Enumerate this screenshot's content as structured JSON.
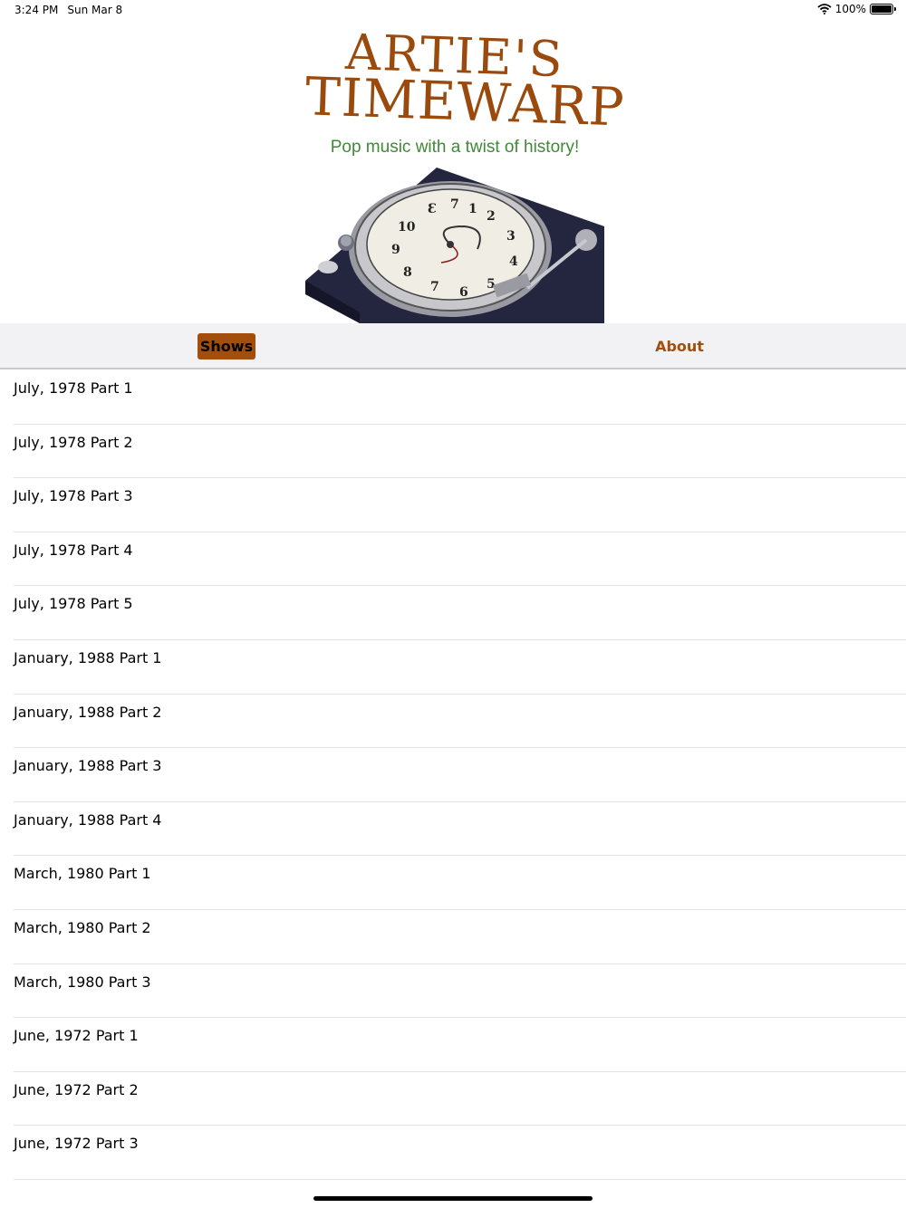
{
  "status_bar": {
    "time": "3:24 PM",
    "date": "Sun Mar 8",
    "battery": "100%",
    "battery_level": 1.0
  },
  "logo": {
    "title_line1": "ARTIE'S",
    "title_line2": "TIMEWARP",
    "tagline": "Pop music with a twist of history!"
  },
  "tabs": {
    "shows": "Shows",
    "about": "About",
    "selected": "Shows"
  },
  "shows": [
    "July, 1978 Part 1",
    "July, 1978 Part 2",
    "July, 1978 Part 3",
    "July, 1978 Part 4",
    "July, 1978 Part 5",
    "January, 1988 Part 1",
    "January, 1988 Part 2",
    "January, 1988 Part 3",
    "January, 1988 Part 4",
    "March, 1980 Part 1",
    "March, 1980 Part 2",
    "March, 1980 Part 3",
    "June, 1972 Part 1",
    "June, 1972 Part 2",
    "June, 1972 Part 3"
  ],
  "colors": {
    "brand_brown": "#a34e0c",
    "tagline_green": "#3f8a36",
    "tab_bar_bg": "#f2f2f4"
  }
}
